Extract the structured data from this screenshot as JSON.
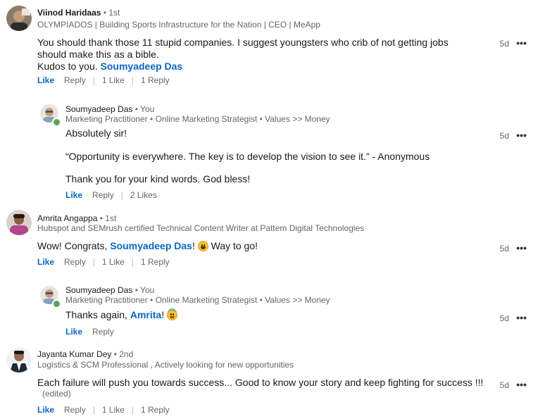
{
  "comments": [
    {
      "name": "Viinod Haridaas",
      "degree": "• 1st",
      "headline": "OLYMPIADOS | Building Sports Infrastructure for the Nation | CEO | MeApp",
      "line1": "You should thank those 11 stupid companies. I suggest youngsters who crib of not getting jobs",
      "line2": "should make this as a bible.",
      "line3_prefix": "Kudos to you. ",
      "mention": "Soumyadeep Das",
      "time": "5d",
      "like": "Like",
      "reply": "Reply",
      "likes": "1 Like",
      "replies": "1 Reply"
    },
    {
      "name": "Soumyadeep Das",
      "degree": "• You",
      "headline": "Marketing Practitioner • Online Marketing Strategist • Values >> Money",
      "para1": "Absolutely sir!",
      "para2": "“Opportunity is everywhere. The key is to develop the vision to see it.” - Anonymous",
      "para3": "Thank you for your kind words. God bless!",
      "time": "5d",
      "like": "Like",
      "reply": "Reply",
      "likes": "2 Likes"
    },
    {
      "name": "Amrita Angappa",
      "degree": "• 1st",
      "headline": "Hubspot and SEMrush certified Technical Content Writer at Pattem Digital Technologies",
      "prefix": "Wow! Congrats, ",
      "mention": "Soumyadeep Das",
      "mid": "! ",
      "emoji": "grinning-face",
      "suffix": " Way to go!",
      "time": "5d",
      "like": "Like",
      "reply": "Reply",
      "likes": "1 Like",
      "replies": "1 Reply"
    },
    {
      "name": "Soumyadeep Das",
      "degree": "• You",
      "headline": "Marketing Practitioner • Online Marketing Strategist • Values >> Money",
      "prefix": "Thanks again, ",
      "mention": "Amrita",
      "mid": "! ",
      "emoji": "smiling-face-with-halo",
      "time": "5d",
      "like": "Like",
      "reply": "Reply"
    },
    {
      "name": "Jayanta Kumar Dey",
      "degree": "• 2nd",
      "headline": "Logistics & SCM Professional , Actively looking for new opportunities",
      "text": "Each failure will push you towards success... Good to know your story and keep fighting for success !!!",
      "edited": "(edited)",
      "time": "5d",
      "like": "Like",
      "reply": "Reply",
      "likes": "1 Like",
      "replies": "1 Reply"
    }
  ],
  "more_glyph": "•••",
  "colors": {
    "link": "#0a66c2",
    "meta": "#666666",
    "online": "#57a55a"
  }
}
